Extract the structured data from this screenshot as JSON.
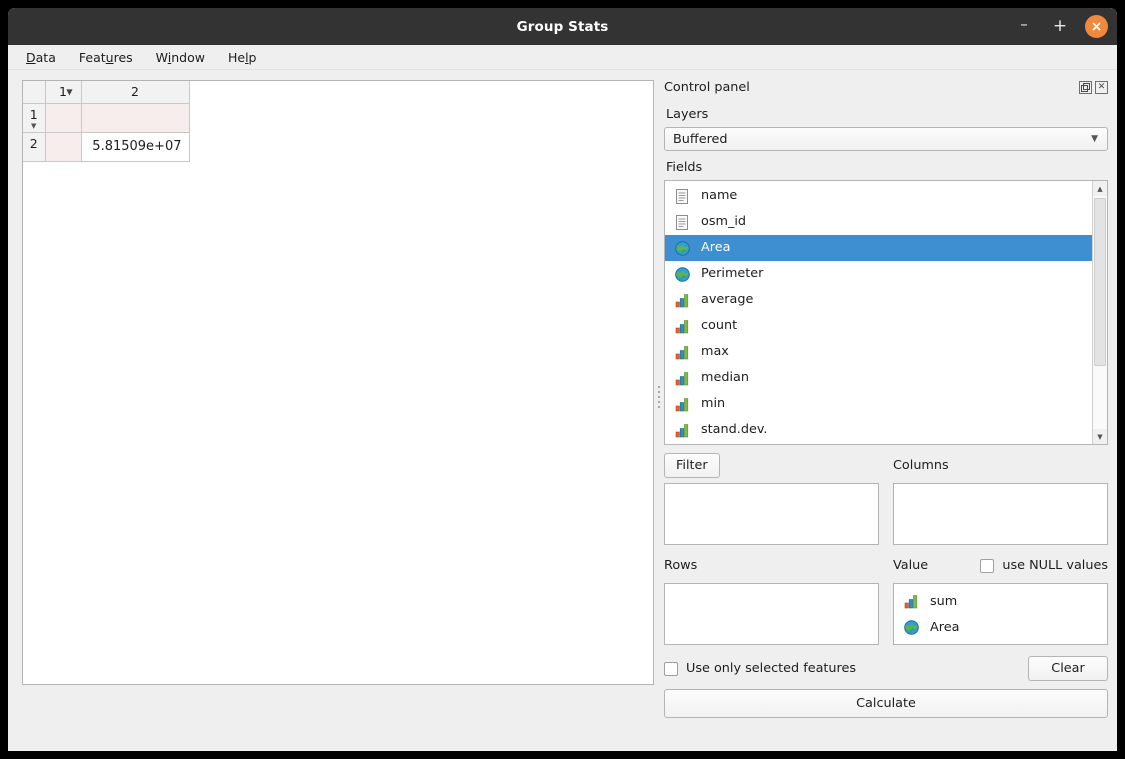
{
  "window": {
    "title": "Group Stats",
    "controls": {
      "minimize": "–",
      "maximize": "+",
      "close": "×"
    }
  },
  "menubar": {
    "items": [
      {
        "label": "Data",
        "mnemonic": "D"
      },
      {
        "label": "Features",
        "mnemonic": "u"
      },
      {
        "label": "Window",
        "mnemonic": "i"
      },
      {
        "label": "Help",
        "mnemonic": "l"
      }
    ]
  },
  "result_table": {
    "columns": [
      "1",
      "2"
    ],
    "sort_indicator_column": "1",
    "rows": [
      {
        "header": "1",
        "cells": [
          "",
          ""
        ]
      },
      {
        "header": "2",
        "cells": [
          "",
          "5.81509e+07"
        ]
      }
    ]
  },
  "control_panel": {
    "title": "Control panel",
    "dock_buttons": {
      "float": "float-icon",
      "close": "✕"
    },
    "layers": {
      "label": "Layers",
      "selected": "Buffered",
      "arrow": "▼"
    },
    "fields": {
      "label": "Fields",
      "items": [
        {
          "name": "name",
          "icon": "text-field-icon",
          "selected": false
        },
        {
          "name": "osm_id",
          "icon": "text-field-icon",
          "selected": false
        },
        {
          "name": "Area",
          "icon": "geometry-globe-icon",
          "selected": true
        },
        {
          "name": "Perimeter",
          "icon": "geometry-globe-icon",
          "selected": false
        },
        {
          "name": "average",
          "icon": "statistic-bars-icon",
          "selected": false
        },
        {
          "name": "count",
          "icon": "statistic-bars-icon",
          "selected": false
        },
        {
          "name": "max",
          "icon": "statistic-bars-icon",
          "selected": false
        },
        {
          "name": "median",
          "icon": "statistic-bars-icon",
          "selected": false
        },
        {
          "name": "min",
          "icon": "statistic-bars-icon",
          "selected": false
        },
        {
          "name": "stand.dev.",
          "icon": "statistic-bars-icon",
          "selected": false
        },
        {
          "name": "",
          "icon": "statistic-bars-icon",
          "selected": false
        }
      ],
      "selection_color": "#3d8fd1"
    },
    "filter": {
      "button_label": "Filter",
      "items": []
    },
    "columns": {
      "label": "Columns",
      "items": []
    },
    "rows": {
      "label": "Rows",
      "items": []
    },
    "value": {
      "label": "Value",
      "items": [
        {
          "name": "sum",
          "icon": "statistic-bars-icon"
        },
        {
          "name": "Area",
          "icon": "geometry-globe-icon"
        }
      ]
    },
    "use_null_values": {
      "label": "use NULL values",
      "checked": false
    },
    "use_only_selected": {
      "label": "Use only selected features",
      "checked": false
    },
    "clear_button": "Clear",
    "calculate_button": "Calculate"
  }
}
